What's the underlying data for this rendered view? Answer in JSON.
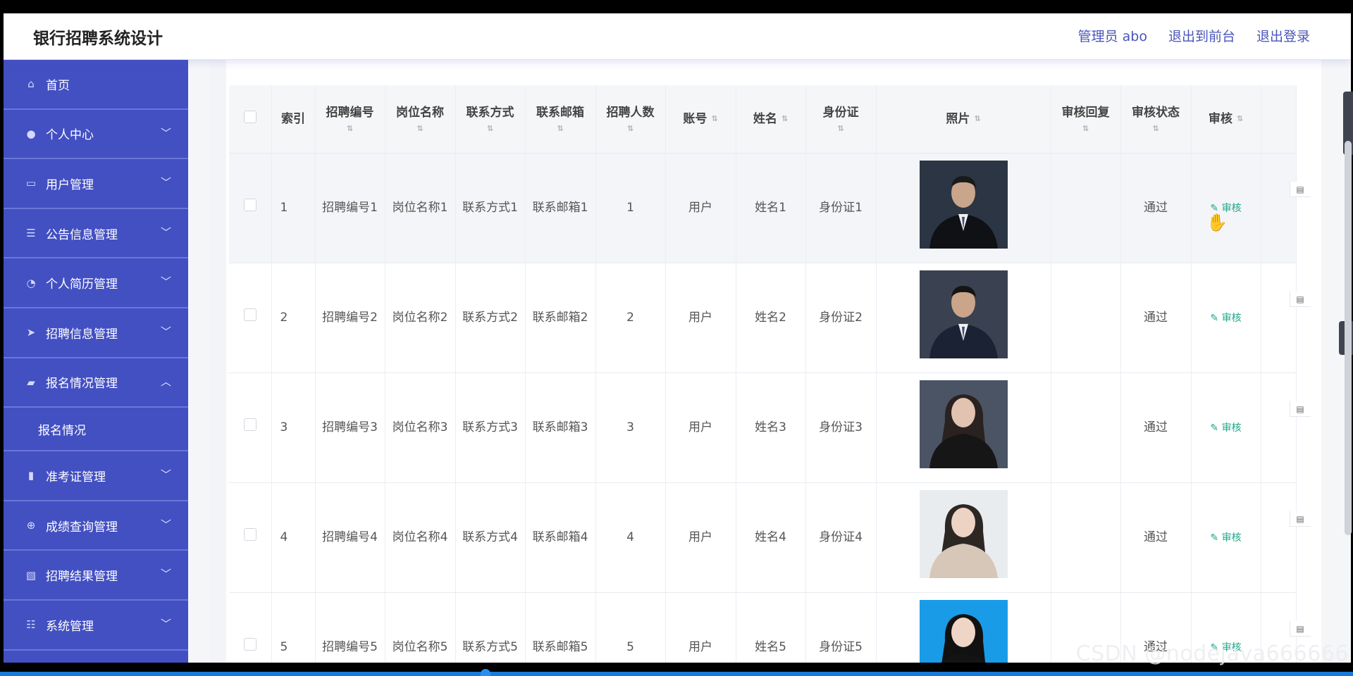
{
  "header": {
    "title": "银行招聘系统设计",
    "admin_label": "管理员 abo",
    "exit_front": "退出到前台",
    "logout": "退出登录"
  },
  "sidebar": {
    "items": [
      {
        "label": "首页",
        "icon": "home-icon",
        "expanded": false,
        "has_chevron": false
      },
      {
        "label": "个人中心",
        "icon": "user-icon",
        "has_chevron": true
      },
      {
        "label": "用户管理",
        "icon": "chat-icon",
        "has_chevron": true
      },
      {
        "label": "公告信息管理",
        "icon": "list-icon",
        "has_chevron": true
      },
      {
        "label": "个人简历管理",
        "icon": "gauge-icon",
        "has_chevron": true
      },
      {
        "label": "招聘信息管理",
        "icon": "send-icon",
        "has_chevron": true
      },
      {
        "label": "报名情况管理",
        "icon": "briefcase-icon",
        "has_chevron": true,
        "expanded": true,
        "sub_items": [
          "报名情况"
        ]
      },
      {
        "label": "准考证管理",
        "icon": "bar-chart-icon",
        "has_chevron": true
      },
      {
        "label": "成绩查询管理",
        "icon": "target-icon",
        "has_chevron": true
      },
      {
        "label": "招聘结果管理",
        "icon": "image-chart-icon",
        "has_chevron": true
      },
      {
        "label": "系统管理",
        "icon": "sliders-icon",
        "has_chevron": true
      }
    ]
  },
  "table": {
    "columns": [
      "索引",
      "招聘编号",
      "岗位名称",
      "联系方式",
      "联系邮箱",
      "招聘人数",
      "账号",
      "姓名",
      "身份证",
      "照片",
      "审核回复",
      "审核状态",
      "审核"
    ],
    "rows": [
      {
        "index": "1",
        "code": "招聘编号1",
        "post": "岗位名称1",
        "contact": "联系方式1",
        "email": "联系邮箱1",
        "count": "1",
        "account": "用户",
        "name": "姓名1",
        "idcard": "身份证1",
        "reply": "",
        "status": "通过",
        "audit": "审核"
      },
      {
        "index": "2",
        "code": "招聘编号2",
        "post": "岗位名称2",
        "contact": "联系方式2",
        "email": "联系邮箱2",
        "count": "2",
        "account": "用户",
        "name": "姓名2",
        "idcard": "身份证2",
        "reply": "",
        "status": "通过",
        "audit": "审核"
      },
      {
        "index": "3",
        "code": "招聘编号3",
        "post": "岗位名称3",
        "contact": "联系方式3",
        "email": "联系邮箱3",
        "count": "3",
        "account": "用户",
        "name": "姓名3",
        "idcard": "身份证3",
        "reply": "",
        "status": "通过",
        "audit": "审核"
      },
      {
        "index": "4",
        "code": "招聘编号4",
        "post": "岗位名称4",
        "contact": "联系方式4",
        "email": "联系邮箱4",
        "count": "4",
        "account": "用户",
        "name": "姓名4",
        "idcard": "身份证4",
        "reply": "",
        "status": "通过",
        "audit": "审核"
      },
      {
        "index": "5",
        "code": "招聘编号5",
        "post": "岗位名称5",
        "contact": "联系方式5",
        "email": "联系邮箱5",
        "count": "5",
        "account": "用户",
        "name": "姓名5",
        "idcard": "身份证5",
        "reply": "",
        "status": "通过",
        "audit": "审核"
      }
    ]
  },
  "colors": {
    "sidebar": "#4350c2",
    "accent_link": "#4a55b9",
    "audit_green": "#21a58a"
  },
  "watermark": "CSDN @nodejava666666"
}
